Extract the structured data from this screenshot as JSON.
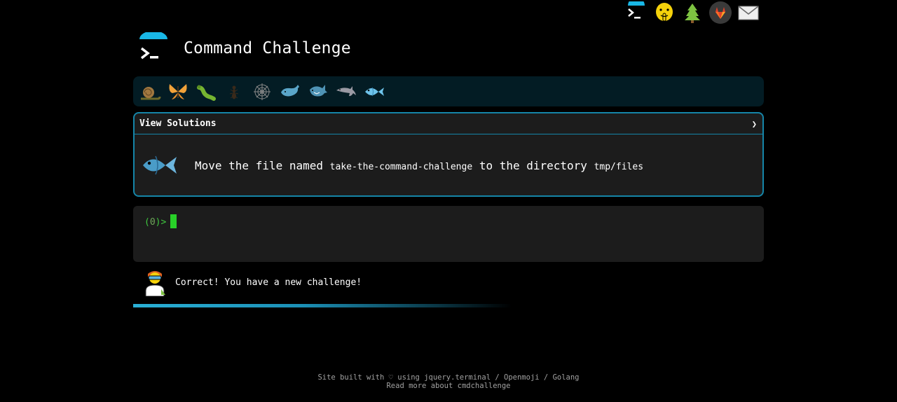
{
  "top_icons": [
    {
      "name": "cmdchallenge-logo-icon"
    },
    {
      "name": "shushing-face-icon"
    },
    {
      "name": "tree-icon"
    },
    {
      "name": "gitlab-icon"
    },
    {
      "name": "envelope-icon"
    }
  ],
  "header": {
    "title": "Command Challenge"
  },
  "levels": [
    {
      "name": "snail-icon"
    },
    {
      "name": "butterfly-icon"
    },
    {
      "name": "caterpillar-icon"
    },
    {
      "name": "ant-icon"
    },
    {
      "name": "spider-web-icon"
    },
    {
      "name": "whale-icon"
    },
    {
      "name": "shark-icon"
    },
    {
      "name": "dolphin-icon"
    },
    {
      "name": "fish-icon",
      "active": true
    }
  ],
  "challenge": {
    "view_solutions_label": "View Solutions",
    "chevron": "❯",
    "text_prefix": "Move the file named",
    "file_name": "take-the-command-challenge",
    "text_middle": "to the directory",
    "directory": "tmp/files"
  },
  "terminal": {
    "prompt_open": "(",
    "prompt_code": "0",
    "prompt_close": ")>"
  },
  "status": {
    "message": "Correct! You have a new challenge!",
    "progress_percent": 60
  },
  "footer": {
    "line1_prefix": "Site built with ♡ using",
    "link_jquery": "jquery.terminal",
    "sep1": "/",
    "link_openmoji": "Openmoji",
    "sep2": "/",
    "link_golang": "Golang",
    "line2_prefix": "Read more about",
    "link_about": "cmdchallenge"
  },
  "colors": {
    "accent": "#1585a8",
    "prompt": "#3fc63f",
    "level_bar_bg": "#031c24"
  }
}
